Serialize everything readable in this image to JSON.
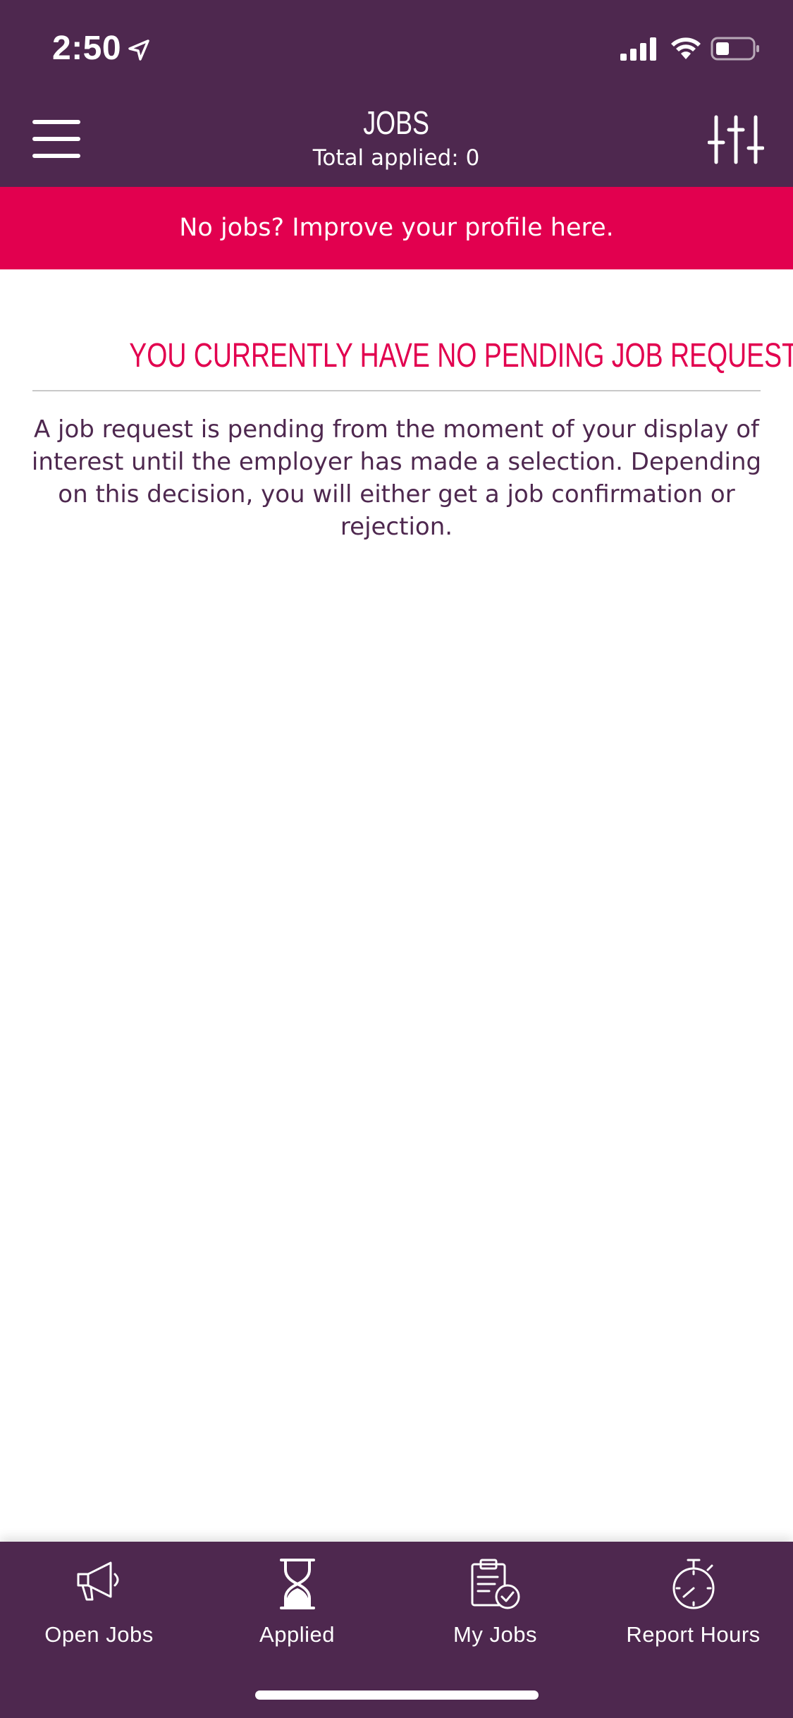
{
  "status_bar": {
    "time": "2:50"
  },
  "header": {
    "title": "JOBS",
    "subtitle": "Total applied: 0"
  },
  "banner": {
    "text": "No jobs? Improve your profile here."
  },
  "empty_state": {
    "title": "YOU CURRENTLY HAVE NO PENDING JOB REQUESTS",
    "body": "A job request is pending from the moment of your display of interest until the employer has made a selection. Depending on this decision, you will either get a job confirmation or rejection."
  },
  "tabs": [
    {
      "label": "Open Jobs",
      "icon": "megaphone-icon"
    },
    {
      "label": "Applied",
      "icon": "hourglass-icon"
    },
    {
      "label": "My Jobs",
      "icon": "clipboard-check-icon"
    },
    {
      "label": "Report Hours",
      "icon": "stopwatch-icon"
    }
  ],
  "colors": {
    "brand_purple": "#4e284f",
    "accent_red": "#e2004f"
  }
}
